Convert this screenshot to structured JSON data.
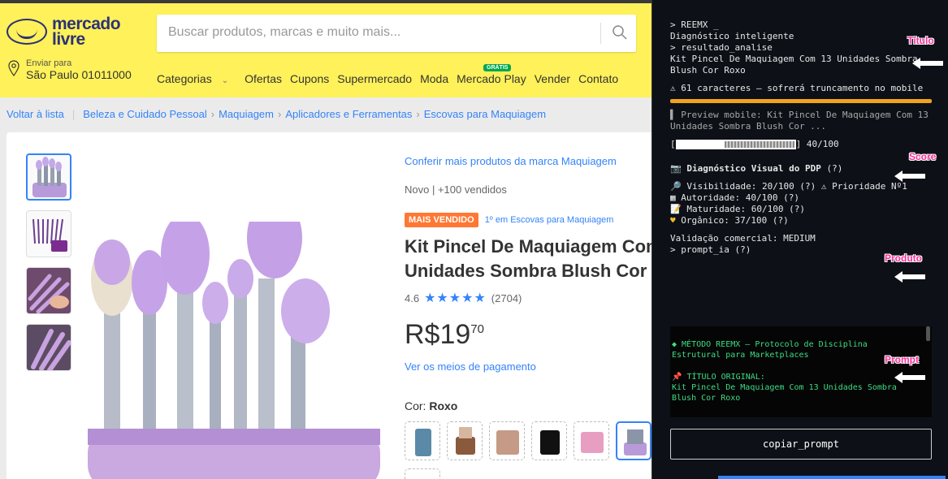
{
  "header": {
    "logo_line1": "mercado",
    "logo_line2": "livre",
    "search_placeholder": "Buscar produtos, marcas e muito mais...",
    "deliver_label": "Enviar para",
    "deliver_city": "São Paulo 01011000",
    "nav": [
      "Categorias",
      "Ofertas",
      "Cupons",
      "Supermercado",
      "Moda",
      "Mercado Play",
      "Vender",
      "Contato"
    ],
    "gratis_badge": "GRÁTIS"
  },
  "breadcrumb": {
    "back": "Voltar à lista",
    "items": [
      "Beleza e Cuidado Pessoal",
      "Maquiagem",
      "Aplicadores e Ferramentas",
      "Escovas para Maquiagem"
    ]
  },
  "product": {
    "brand_link": "Conferir mais produtos da marca Maquiagem",
    "condition": "Novo  |  +100 vendidos",
    "badge": "MAIS VENDIDO",
    "rank": "1º em Escovas para Maquiagem",
    "title_line1": "Kit Pincel De Maquiagem Com",
    "title_line2": "Unidades Sombra Blush Cor Ro",
    "rating": "4.6",
    "stars": "★★★★★",
    "reviews": "(2704)",
    "price_int": "R$19",
    "price_cents": "70",
    "pay_link": "Ver os meios de pagamento",
    "color_label": "Cor:",
    "color_value": "Roxo"
  },
  "panel": {
    "line_brand": "> REEMX _",
    "line_sub": "Diagnóstico inteligente",
    "line_result": "> resultado_analise",
    "title_text": "Kit Pincel De Maquiagem Com 13 Unidades Sombra Blush Cor Roxo",
    "warn": "⚠ 61 caracteres — sofrerá truncamento no mobile",
    "preview": "▌ Preview mobile: Kit Pincel De Maquiagem Com 13 Unidades Sombra Blush Cor ...",
    "score_prefix": "[",
    "score_text": "] 40/100",
    "diag_title": "Diagnóstico Visual do PDP",
    "q": "(?)",
    "visibility": "Visibilidade: 20/100",
    "priority": "⚠ Prioridade Nº1",
    "authority": "Autoridade: 40/100",
    "maturity": "Maturidade: 60/100",
    "organic": "Orgânico: 37/100",
    "validation": "Validação comercial: MEDIUM",
    "prompt_ia": "> prompt_ia (?)",
    "method": "◆ MÉTODO REEMX — Protocolo de Disciplina Estrutural para Marketplaces",
    "orig_title_label": "📌 TÍTULO ORIGINAL:",
    "orig_title": "Kit Pincel De Maquiagem Com 13 Unidades Sombra Blush Cor Roxo",
    "copy_button": "copiar_prompt",
    "tags": {
      "titulo": "Título",
      "score": "Score",
      "produto": "Produto",
      "prompt": "Prompt"
    }
  },
  "colors": {
    "ml_yellow": "#fff159",
    "ml_blue": "#3483fa",
    "badge_orange": "#ff7733",
    "panel_bg": "#0d1117",
    "terminal_green": "#3ddc84",
    "warn_orange": "#f2a31b",
    "tag_pink": "#ff2d9a"
  }
}
